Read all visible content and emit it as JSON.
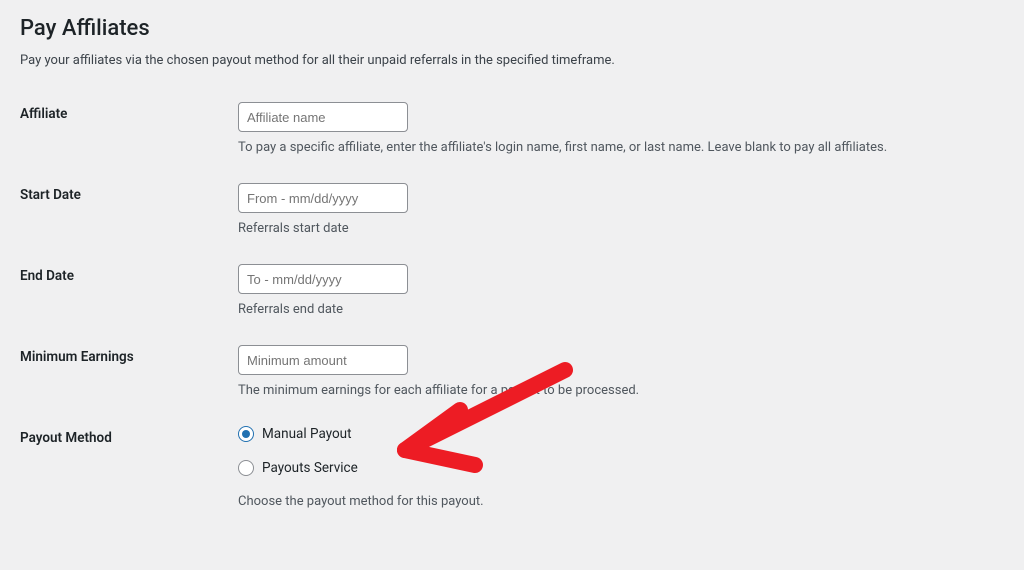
{
  "page": {
    "title": "Pay Affiliates",
    "intro": "Pay your affiliates via the chosen payout method for all their unpaid referrals in the specified timeframe."
  },
  "fields": {
    "affiliate": {
      "label": "Affiliate",
      "placeholder": "Affiliate name",
      "description": "To pay a specific affiliate, enter the affiliate's login name, first name, or last name. Leave blank to pay all affiliates."
    },
    "start_date": {
      "label": "Start Date",
      "placeholder": "From - mm/dd/yyyy",
      "description": "Referrals start date"
    },
    "end_date": {
      "label": "End Date",
      "placeholder": "To - mm/dd/yyyy",
      "description": "Referrals end date"
    },
    "min_earnings": {
      "label": "Minimum Earnings",
      "placeholder": "Minimum amount",
      "description": "The minimum earnings for each affiliate for a payout to be processed."
    },
    "payout_method": {
      "label": "Payout Method",
      "options": {
        "manual": "Manual Payout",
        "service": "Payouts Service"
      },
      "description": "Choose the payout method for this payout."
    }
  },
  "annotation": {
    "color": "#ed1c24"
  }
}
